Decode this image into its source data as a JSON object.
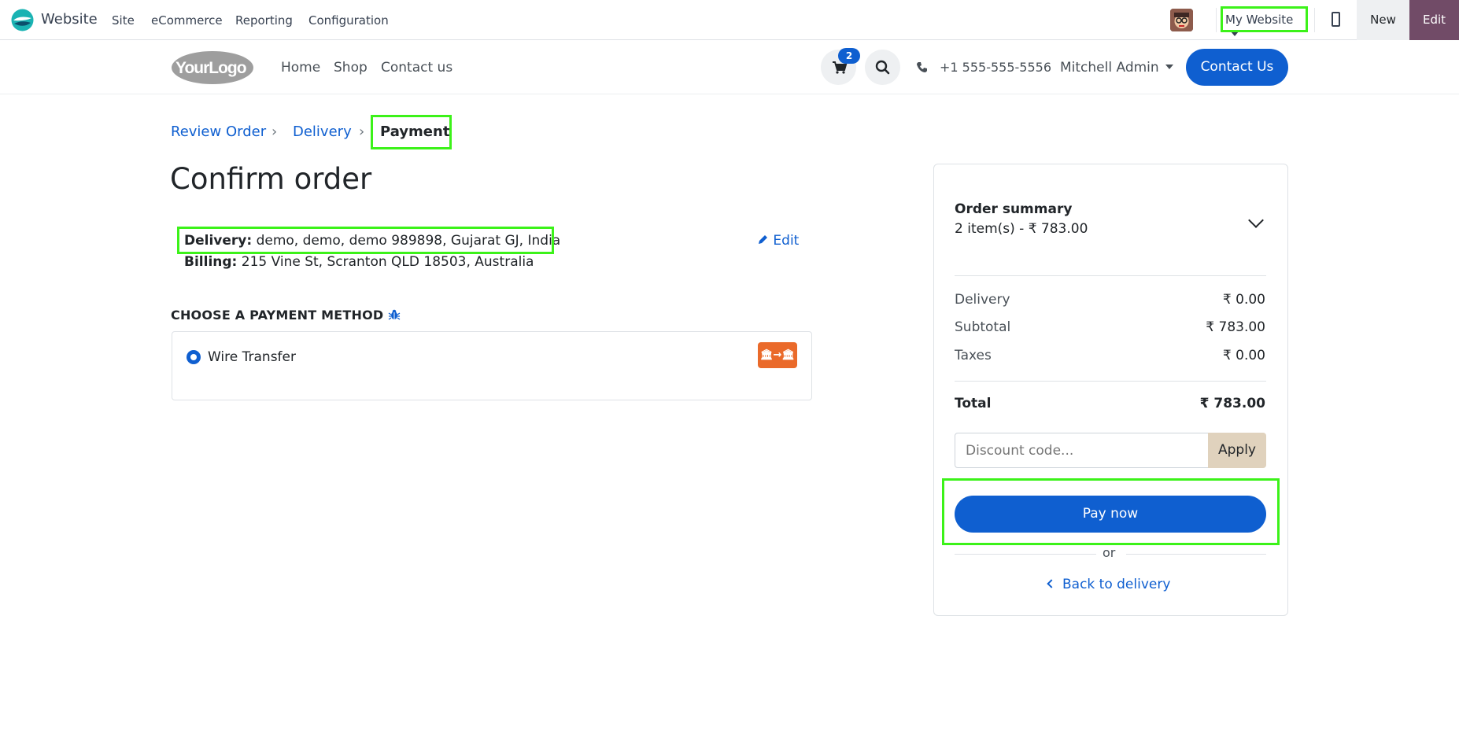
{
  "adminbar": {
    "app_name": "Website",
    "menu": [
      "Site",
      "eCommerce",
      "Reporting",
      "Configuration"
    ],
    "website_switcher": "My Website",
    "new_label": "New",
    "edit_label": "Edit"
  },
  "header": {
    "logo_text": "YourLogo",
    "nav": [
      "Home",
      "Shop",
      "Contact us"
    ],
    "cart_count": "2",
    "phone": "+1 555-555-5556",
    "user": "Mitchell Admin",
    "contact_button": "Contact Us"
  },
  "breadcrumb": {
    "steps": [
      "Review Order",
      "Delivery"
    ],
    "active": "Payment",
    "separator": "›"
  },
  "page_title": "Confirm order",
  "addresses": {
    "delivery_label": "Delivery:",
    "delivery_value": "demo, demo, demo 989898, Gujarat GJ, India",
    "billing_label": "Billing:",
    "billing_value": "215 Vine St, Scranton QLD 18503, Australia",
    "edit_label": "Edit"
  },
  "payment": {
    "section_title": "CHOOSE A PAYMENT METHOD",
    "method_label": "Wire Transfer",
    "method_selected": true
  },
  "summary": {
    "title": "Order summary",
    "subtitle": "2 item(s) -  ₹ 783.00",
    "rows": [
      {
        "label": "Delivery",
        "value": "₹ 0.00"
      },
      {
        "label": "Subtotal",
        "value": "₹ 783.00"
      },
      {
        "label": "Taxes",
        "value": "₹ 0.00"
      }
    ],
    "total_label": "Total",
    "total_value": "₹ 783.00",
    "discount_placeholder": "Discount code...",
    "apply_label": "Apply",
    "pay_label": "Pay now",
    "or_label": "or",
    "back_label": "Back to delivery"
  },
  "colors": {
    "primary": "#0f5fd0",
    "admin_edit": "#714b67",
    "apply_bg": "#e0d2bd",
    "highlight": "#3cf219",
    "wire_icon": "#ea6a2a"
  }
}
